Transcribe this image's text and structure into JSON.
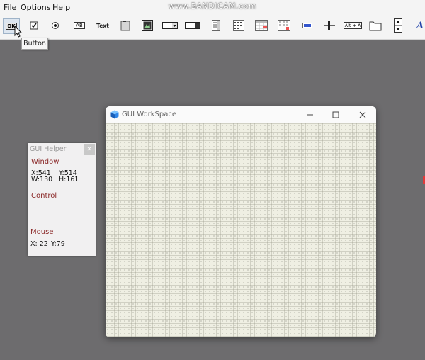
{
  "menubar": {
    "items": [
      "File",
      "Options",
      "Help"
    ]
  },
  "watermark": "www.BANDICAM.com",
  "toolbar": {
    "tools": [
      {
        "name": "button-tool",
        "label": "OK"
      },
      {
        "name": "checkbox-tool",
        "label": ""
      },
      {
        "name": "radio-tool",
        "label": ""
      },
      {
        "name": "edit-tool",
        "label": "AB"
      },
      {
        "name": "text-tool",
        "label": "Text"
      },
      {
        "name": "group-tool",
        "label": ""
      },
      {
        "name": "picture-tool",
        "label": ""
      },
      {
        "name": "combo-tool",
        "label": ""
      },
      {
        "name": "dropdown-tool",
        "label": ""
      },
      {
        "name": "listbox-tool",
        "label": ""
      },
      {
        "name": "listview-tool",
        "label": ""
      },
      {
        "name": "calendar-tool",
        "label": ""
      },
      {
        "name": "tab-tool",
        "label": ""
      },
      {
        "name": "progress-tool",
        "label": ""
      },
      {
        "name": "slider-tool",
        "label": ""
      },
      {
        "name": "hotkey-tool",
        "label": "Alt + A"
      },
      {
        "name": "folder-tool",
        "label": ""
      },
      {
        "name": "updown-tool",
        "label": ""
      },
      {
        "name": "font-tool",
        "label": "A"
      }
    ]
  },
  "tooltip": "Button",
  "helper": {
    "title": "GUI Helper",
    "window_label": "Window",
    "x_val": "X:541",
    "y_val": "Y:514",
    "w_val": "W:130",
    "h_val": "H:161",
    "control_label": "Control",
    "mouse_label": "Mouse",
    "mouse_x": "X: 22",
    "mouse_y": "Y:79"
  },
  "workspace": {
    "title": "GUI WorkSpace"
  }
}
